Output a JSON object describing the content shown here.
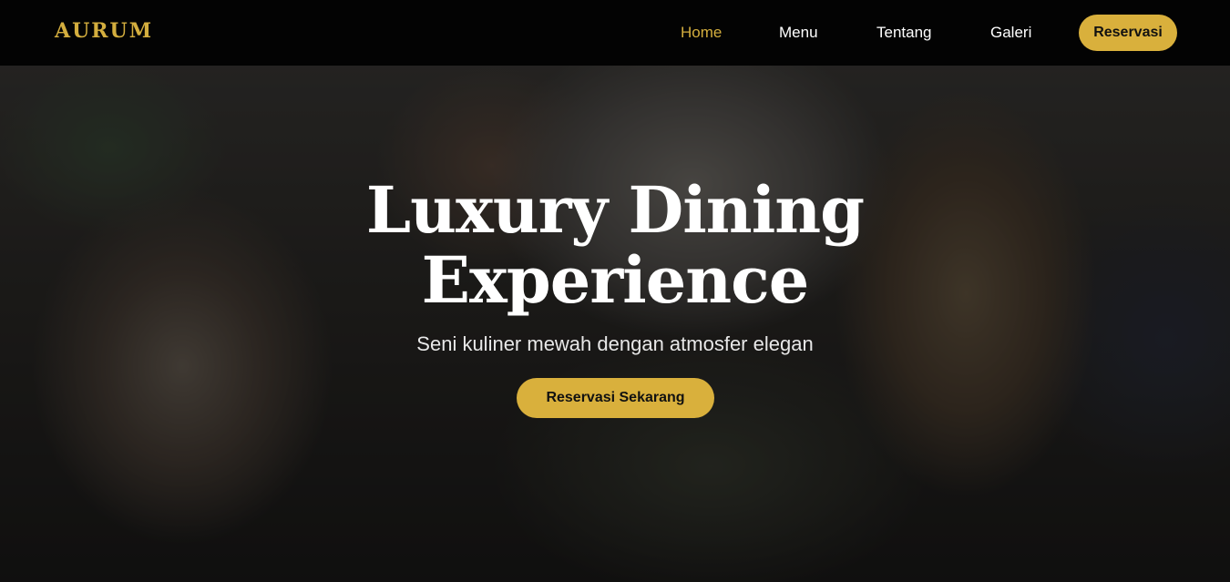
{
  "brand": {
    "name": "AURUM"
  },
  "nav": {
    "items": [
      {
        "label": "Home",
        "active": true
      },
      {
        "label": "Menu",
        "active": false
      },
      {
        "label": "Tentang",
        "active": false
      },
      {
        "label": "Galeri",
        "active": false
      }
    ],
    "cta_label": "Reservasi"
  },
  "hero": {
    "title_line1": "Luxury Dining",
    "title_line2": "Experience",
    "subtitle": "Seni kuliner mewah dengan atmosfer elegan",
    "cta_label": "Reservasi Sekarang",
    "background": "blurred-restaurant-diners-photo"
  },
  "colors": {
    "accent": "#d9b03c",
    "logo": "#d4ae3e",
    "nav_background": "#030303",
    "text": "#ffffff"
  }
}
